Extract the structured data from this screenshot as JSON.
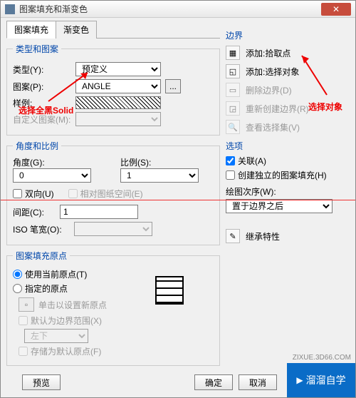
{
  "window": {
    "title": "图案填充和渐变色"
  },
  "tabs": {
    "fill": "图案填充",
    "gradient": "渐变色"
  },
  "type_group": {
    "legend": "类型和图案",
    "type_label": "类型(Y):",
    "type_value": "预定义",
    "pattern_label": "图案(P):",
    "pattern_value": "ANGLE",
    "swatch_btn": "...",
    "sample_label": "样例:",
    "custom_label": "自定义图案(M):"
  },
  "angle_group": {
    "legend": "角度和比例",
    "angle_label": "角度(G):",
    "angle_value": "0",
    "scale_label": "比例(S):",
    "scale_value": "1",
    "bidir": "双向(U)",
    "paper_space": "相对图纸空间(E)",
    "spacing_label": "间距(C):",
    "spacing_value": "1",
    "iso_label": "ISO 笔宽(O):"
  },
  "origin_group": {
    "legend": "图案填充原点",
    "use_current": "使用当前原点(T)",
    "specify": "指定的原点",
    "click_set": "单击以设置新原点",
    "default_bound": "默认为边界范围(X)",
    "corner_value": "左下",
    "store_default": "存储为默认原点(F)"
  },
  "boundary": {
    "title": "边界",
    "add_pick": "添加:拾取点",
    "add_select": "添加:选择对象",
    "remove": "删除边界(D)",
    "recreate": "重新创建边界(R)",
    "view_sel": "查看选择集(V)"
  },
  "options": {
    "title": "选项",
    "assoc": "关联(A)",
    "independent": "创建独立的图案填充(H)",
    "draw_order_label": "绘图次序(W):",
    "draw_order_value": "置于边界之后",
    "inherit": "继承特性"
  },
  "buttons": {
    "preview": "预览",
    "ok": "确定",
    "cancel": "取消"
  },
  "annotations": {
    "select_solid": "选择全黑Solid",
    "select_obj": "选择对象"
  },
  "logo": {
    "brand": "溜溜自学",
    "site": "ZIXUE.3D66.COM"
  }
}
